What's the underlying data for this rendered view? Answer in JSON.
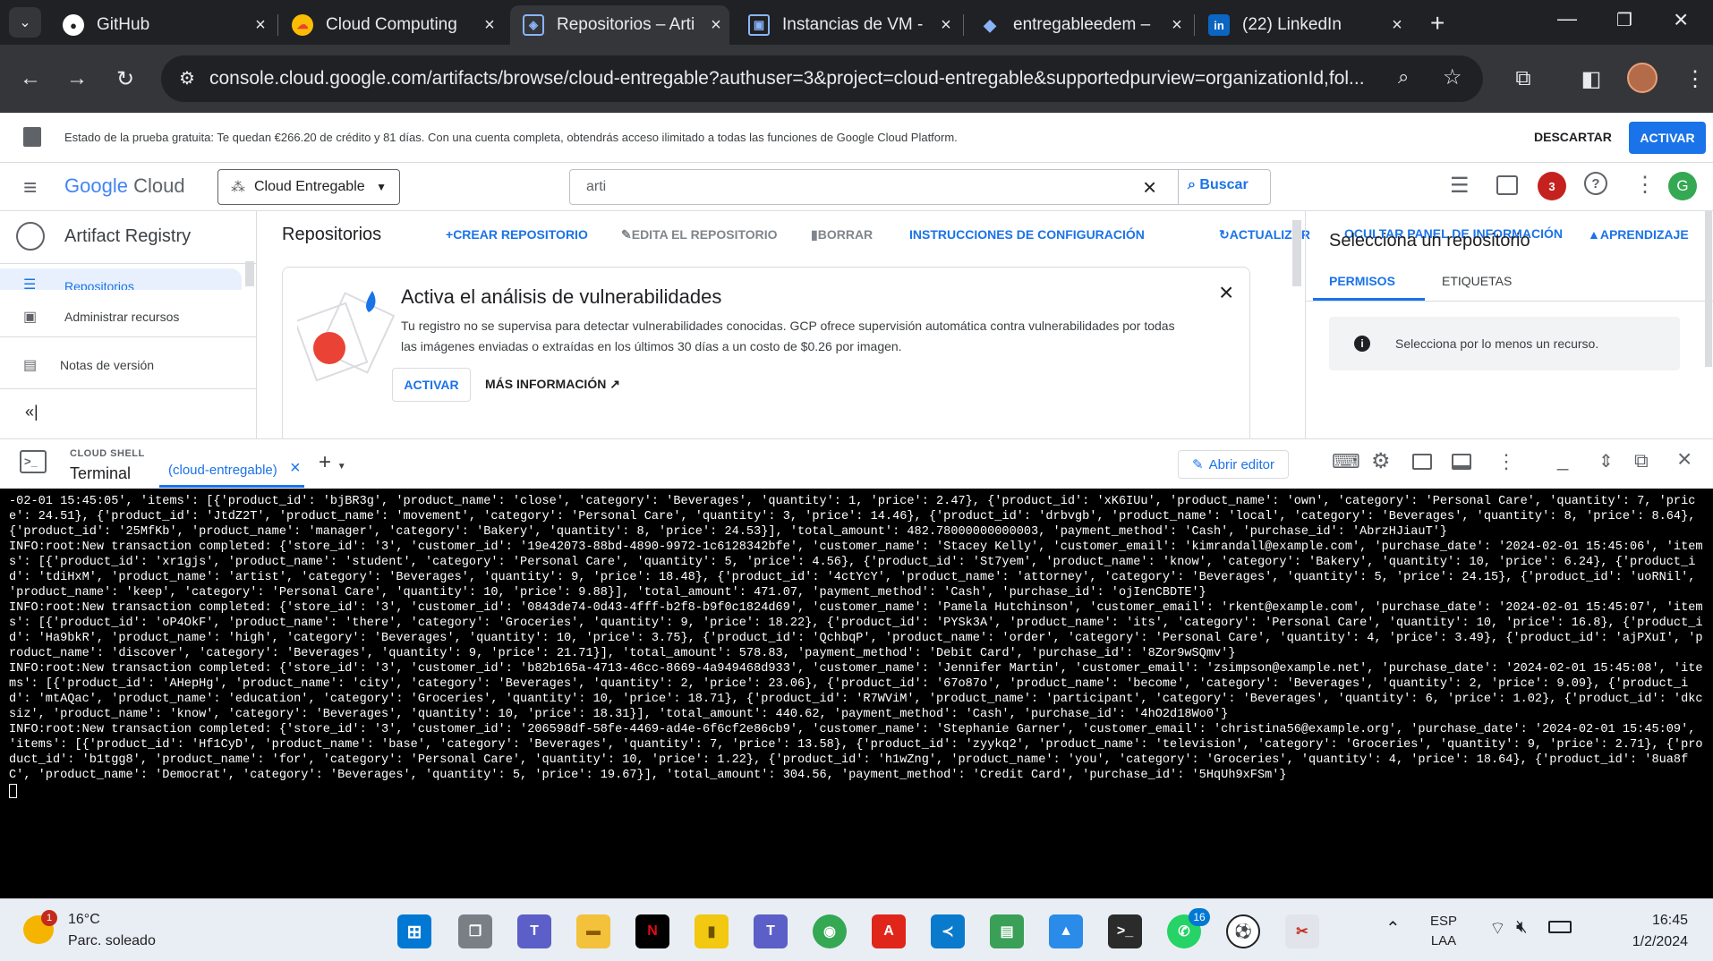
{
  "browser": {
    "tabs": [
      {
        "title": "GitHub",
        "icon": "github-icon",
        "color": "#ffffff"
      },
      {
        "title": "Cloud Computing",
        "icon": "google-cloud-icon",
        "color": "#fbbc04"
      },
      {
        "title": "Repositorios – Arti",
        "icon": "artifact-registry-icon",
        "color": "#8ab4f8"
      },
      {
        "title": "Instancias de VM -",
        "icon": "compute-engine-icon",
        "color": "#8ab4f8"
      },
      {
        "title": "entregableedem –",
        "icon": "cloud-layers-icon",
        "color": "#8ab4f8"
      },
      {
        "title": "(22) LinkedIn",
        "icon": "linkedin-icon",
        "color": "#0a66c2"
      }
    ],
    "url": "console.cloud.google.com/artifacts/browse/cloud-entregable?authuser=3&project=cloud-entregable&supportedpurview=organizationId,fol..."
  },
  "trial": {
    "text": "Estado de la prueba gratuita: Te quedan €266.20 de crédito y 81 días. Con una cuenta completa, obtendrás acceso ilimitado a todas las funciones de Google Cloud Platform.",
    "dismiss": "DESCARTAR",
    "activate": "ACTIVAR"
  },
  "header": {
    "logo_google": "Google",
    "logo_cloud": "Cloud",
    "project": "Cloud Entregable",
    "search_value": "arti",
    "search_button": "Buscar",
    "notifications": "3",
    "avatar": "G"
  },
  "nav": {
    "product": "Artifact Registry",
    "items": [
      {
        "label": "Repositorios"
      },
      {
        "label": "Administrar recursos"
      },
      {
        "label": "Notas de versión"
      }
    ]
  },
  "main": {
    "title": "Repositorios",
    "actions": {
      "create": "CREAR REPOSITORIO",
      "edit": "EDITA EL REPOSITORIO",
      "delete": "BORRAR",
      "setup": "INSTRUCCIONES DE CONFIGURACIÓN",
      "refresh": "ACTUALIZAR",
      "hide_panel": "OCULTAR PANEL DE INFORMACIÓN",
      "learn": "APRENDIZAJE"
    },
    "card": {
      "title": "Activa el análisis de vulnerabilidades",
      "body": "Tu registro no se supervisa para detectar vulnerabilidades conocidas. GCP ofrece supervisión automática contra vulnerabilidades por todas las imágenes enviadas o extraídas en los últimos 30 días a un costo de $0.26 por imagen.",
      "activate": "ACTIVAR",
      "more": "MÁS INFORMACIÓN"
    }
  },
  "info_panel": {
    "title": "Selecciona un repositorio",
    "tab_permissions": "PERMISOS",
    "tab_labels": "ETIQUETAS",
    "notice": "Selecciona por lo menos un recurso."
  },
  "shell": {
    "caption": "CLOUD SHELL",
    "title": "Terminal",
    "tab": "(cloud-entregable)",
    "open_editor": "Abrir editor",
    "output": [
      "-02-01 15:45:05', 'items': [{'product_id': 'bjBR3g', 'product_name': 'close', 'category': 'Beverages', 'quantity': 1, 'price': 2.47}, {'product_id': 'xK6IUu', 'product_name': 'own', 'category': 'Personal Care', 'quantity': 7, 'price': 24.51}, {'product_id': 'JtdZ2T', 'product_name': 'movement', 'category': 'Personal Care', 'quantity': 3, 'price': 14.46}, {'product_id': 'drbvgb', 'product_name': 'local', 'category': 'Beverages', 'quantity': 8, 'price': 8.64}, {'product_id': '25MfKb', 'product_name': 'manager', 'category': 'Bakery', 'quantity': 8, 'price': 24.53}], 'total_amount': 482.78000000000003, 'payment_method': 'Cash', 'purchase_id': 'AbrzHJiauT'}",
      "INFO:root:New transaction completed: {'store_id': '3', 'customer_id': '19e42073-88bd-4890-9972-1c6128342bfe', 'customer_name': 'Stacey Kelly', 'customer_email': 'kimrandall@example.com', 'purchase_date': '2024-02-01 15:45:06', 'items': [{'product_id': 'xr1gjs', 'product_name': 'student', 'category': 'Personal Care', 'quantity': 5, 'price': 4.56}, {'product_id': 'St7yem', 'product_name': 'know', 'category': 'Bakery', 'quantity': 10, 'price': 6.24}, {'product_id': 'tdiHxM', 'product_name': 'artist', 'category': 'Beverages', 'quantity': 9, 'price': 18.48}, {'product_id': '4ctYcY', 'product_name': 'attorney', 'category': 'Beverages', 'quantity': 5, 'price': 24.15}, {'product_id': 'uoRNil', 'product_name': 'keep', 'category': 'Personal Care', 'quantity': 10, 'price': 9.88}], 'total_amount': 471.07, 'payment_method': 'Cash', 'purchase_id': 'ojIenCBDTE'}",
      "INFO:root:New transaction completed: {'store_id': '3', 'customer_id': '0843de74-0d43-4fff-b2f8-b9f0c1824d69', 'customer_name': 'Pamela Hutchinson', 'customer_email': 'rkent@example.com', 'purchase_date': '2024-02-01 15:45:07', 'items': [{'product_id': 'oP4OkF', 'product_name': 'there', 'category': 'Groceries', 'quantity': 9, 'price': 18.22}, {'product_id': 'PYSk3A', 'product_name': 'its', 'category': 'Personal Care', 'quantity': 10, 'price': 16.8}, {'product_id': 'Ha9bkR', 'product_name': 'high', 'category': 'Beverages', 'quantity': 10, 'price': 3.75}, {'product_id': 'QchbqP', 'product_name': 'order', 'category': 'Personal Care', 'quantity': 4, 'price': 3.49}, {'product_id': 'ajPXuI', 'product_name': 'discover', 'category': 'Beverages', 'quantity': 9, 'price': 21.71}], 'total_amount': 578.83, 'payment_method': 'Debit Card', 'purchase_id': '8Zor9wSQmv'}",
      "INFO:root:New transaction completed: {'store_id': '3', 'customer_id': 'b82b165a-4713-46cc-8669-4a949468d933', 'customer_name': 'Jennifer Martin', 'customer_email': 'zsimpson@example.net', 'purchase_date': '2024-02-01 15:45:08', 'items': [{'product_id': 'AHepHg', 'product_name': 'city', 'category': 'Beverages', 'quantity': 2, 'price': 23.06}, {'product_id': '67o87o', 'product_name': 'become', 'category': 'Beverages', 'quantity': 2, 'price': 9.09}, {'product_id': 'mtAQac', 'product_name': 'education', 'category': 'Groceries', 'quantity': 10, 'price': 18.71}, {'product_id': 'R7WViM', 'product_name': 'participant', 'category': 'Beverages', 'quantity': 6, 'price': 1.02}, {'product_id': 'dkcsiz', 'product_name': 'know', 'category': 'Beverages', 'quantity': 10, 'price': 18.31}], 'total_amount': 440.62, 'payment_method': 'Cash', 'purchase_id': '4hO2d18Wo0'}",
      "INFO:root:New transaction completed: {'store_id': '3', 'customer_id': '206598df-58fe-4469-ad4e-6f6cf2e86cb9', 'customer_name': 'Stephanie Garner', 'customer_email': 'christina56@example.org', 'purchase_date': '2024-02-01 15:45:09', 'items': [{'product_id': 'Hf1CyD', 'product_name': 'base', 'category': 'Beverages', 'quantity': 7, 'price': 13.58}, {'product_id': 'zyykq2', 'product_name': 'television', 'category': 'Groceries', 'quantity': 9, 'price': 2.71}, {'product_id': 'b1tgg8', 'product_name': 'for', 'category': 'Personal Care', 'quantity': 10, 'price': 1.22}, {'product_id': 'h1wZng', 'product_name': 'you', 'category': 'Groceries', 'quantity': 4, 'price': 18.64}, {'product_id': '8ua8fC', 'product_name': 'Democrat', 'category': 'Beverages', 'quantity': 5, 'price': 19.67}], 'total_amount': 304.56, 'payment_method': 'Credit Card', 'purchase_id': '5HqUh9xFSm'}"
    ]
  },
  "taskbar": {
    "weather_temp": "16°C",
    "weather_desc": "Parc. soleado",
    "weather_badge": "1",
    "lang": "ESP",
    "layout": "LAA",
    "time": "16:45",
    "date": "1/2/2024",
    "whatsapp_badge": "16"
  }
}
